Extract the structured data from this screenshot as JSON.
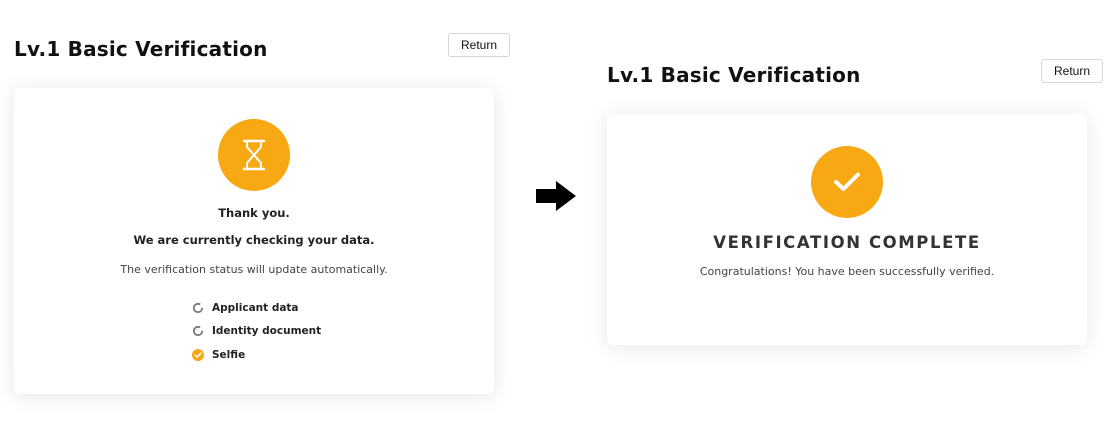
{
  "left_panel": {
    "title": "Lv.1 Basic Verification",
    "return_label": "Return",
    "status_icon": "hourglass-icon",
    "heading1": "Thank you.",
    "heading2": "We are currently checking your data.",
    "info": "The verification status will update automatically.",
    "checklist": [
      {
        "label": "Applicant data",
        "status": "pending"
      },
      {
        "label": "Identity document",
        "status": "pending"
      },
      {
        "label": "Selfie",
        "status": "complete"
      }
    ]
  },
  "transition_icon": "arrow-right-icon",
  "right_panel": {
    "title": "Lv.1 Basic Verification",
    "return_label": "Return",
    "status_icon": "checkmark-icon",
    "heading": "VERIFICATION COMPLETE",
    "message": "Congratulations! You have been successfully verified."
  },
  "colors": {
    "accent": "#F7A812",
    "pending_ring": "#777777",
    "text": "#222222"
  }
}
